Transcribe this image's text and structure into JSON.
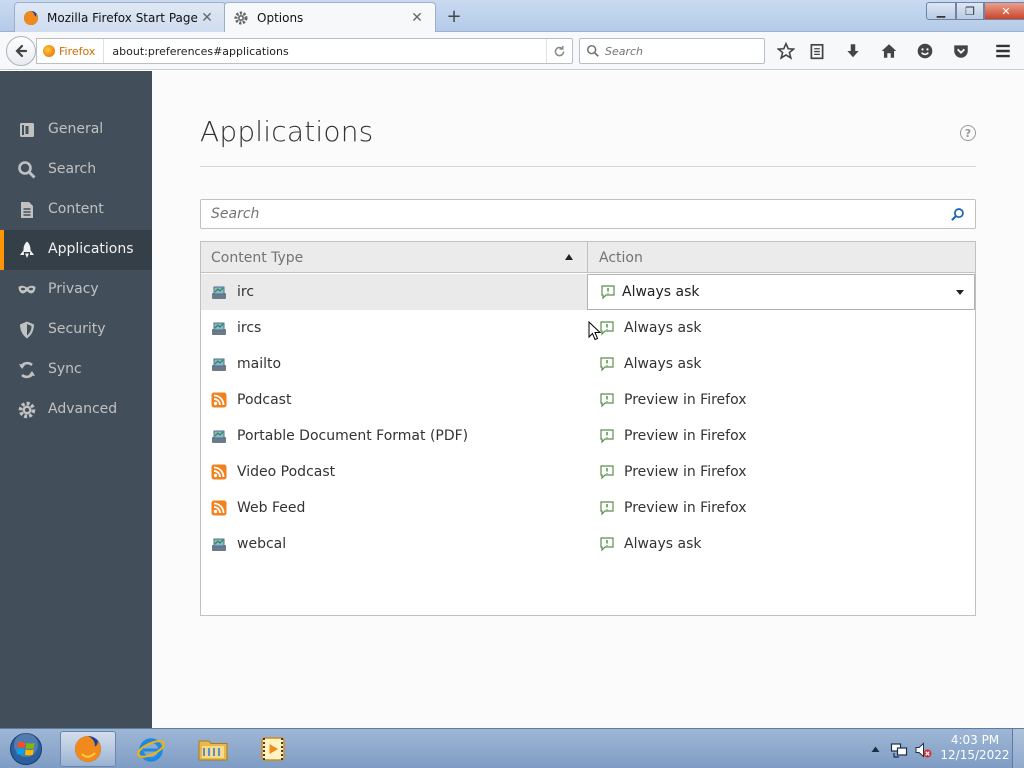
{
  "browser": {
    "tabs": [
      {
        "title": "Mozilla Firefox Start Page",
        "close": "✕"
      },
      {
        "title": "Options",
        "close": "✕"
      }
    ],
    "new_tab": "+",
    "identity_label": "Firefox",
    "url": "about:preferences#applications",
    "search_placeholder": "Search",
    "window_controls": {
      "minimize": "▁",
      "maximize": "❐",
      "close": "✕"
    }
  },
  "sidebar": {
    "items": [
      {
        "label": "General",
        "icon": "general-icon"
      },
      {
        "label": "Search",
        "icon": "search-icon"
      },
      {
        "label": "Content",
        "icon": "content-icon"
      },
      {
        "label": "Applications",
        "icon": "applications-icon",
        "selected": true
      },
      {
        "label": "Privacy",
        "icon": "privacy-mask-icon"
      },
      {
        "label": "Security",
        "icon": "security-icon"
      },
      {
        "label": "Sync",
        "icon": "sync-icon"
      },
      {
        "label": "Advanced",
        "icon": "advanced-icon"
      }
    ]
  },
  "main": {
    "title": "Applications",
    "help": "?",
    "filter_placeholder": "Search",
    "table": {
      "headers": {
        "content_type": "Content Type",
        "action": "Action"
      },
      "rows": [
        {
          "type": "irc",
          "icon": "protocol",
          "action": "Always ask"
        },
        {
          "type": "ircs",
          "icon": "protocol",
          "action": "Always ask"
        },
        {
          "type": "mailto",
          "icon": "protocol",
          "action": "Always ask"
        },
        {
          "type": "Podcast",
          "icon": "feed",
          "action": "Preview in Firefox"
        },
        {
          "type": "Portable Document Format (PDF)",
          "icon": "protocol",
          "action": "Preview in Firefox"
        },
        {
          "type": "Video Podcast",
          "icon": "feed",
          "action": "Preview in Firefox"
        },
        {
          "type": "Web Feed",
          "icon": "feed",
          "action": "Preview in Firefox"
        },
        {
          "type": "webcal",
          "icon": "protocol",
          "action": "Always ask"
        }
      ]
    }
  },
  "taskbar": {
    "time": "4:03 PM",
    "date": "12/15/2022"
  },
  "colors": {
    "sidebar_bg": "#424f5a",
    "sidebar_selected_bg": "#343f48",
    "accent": "#ff9500"
  }
}
